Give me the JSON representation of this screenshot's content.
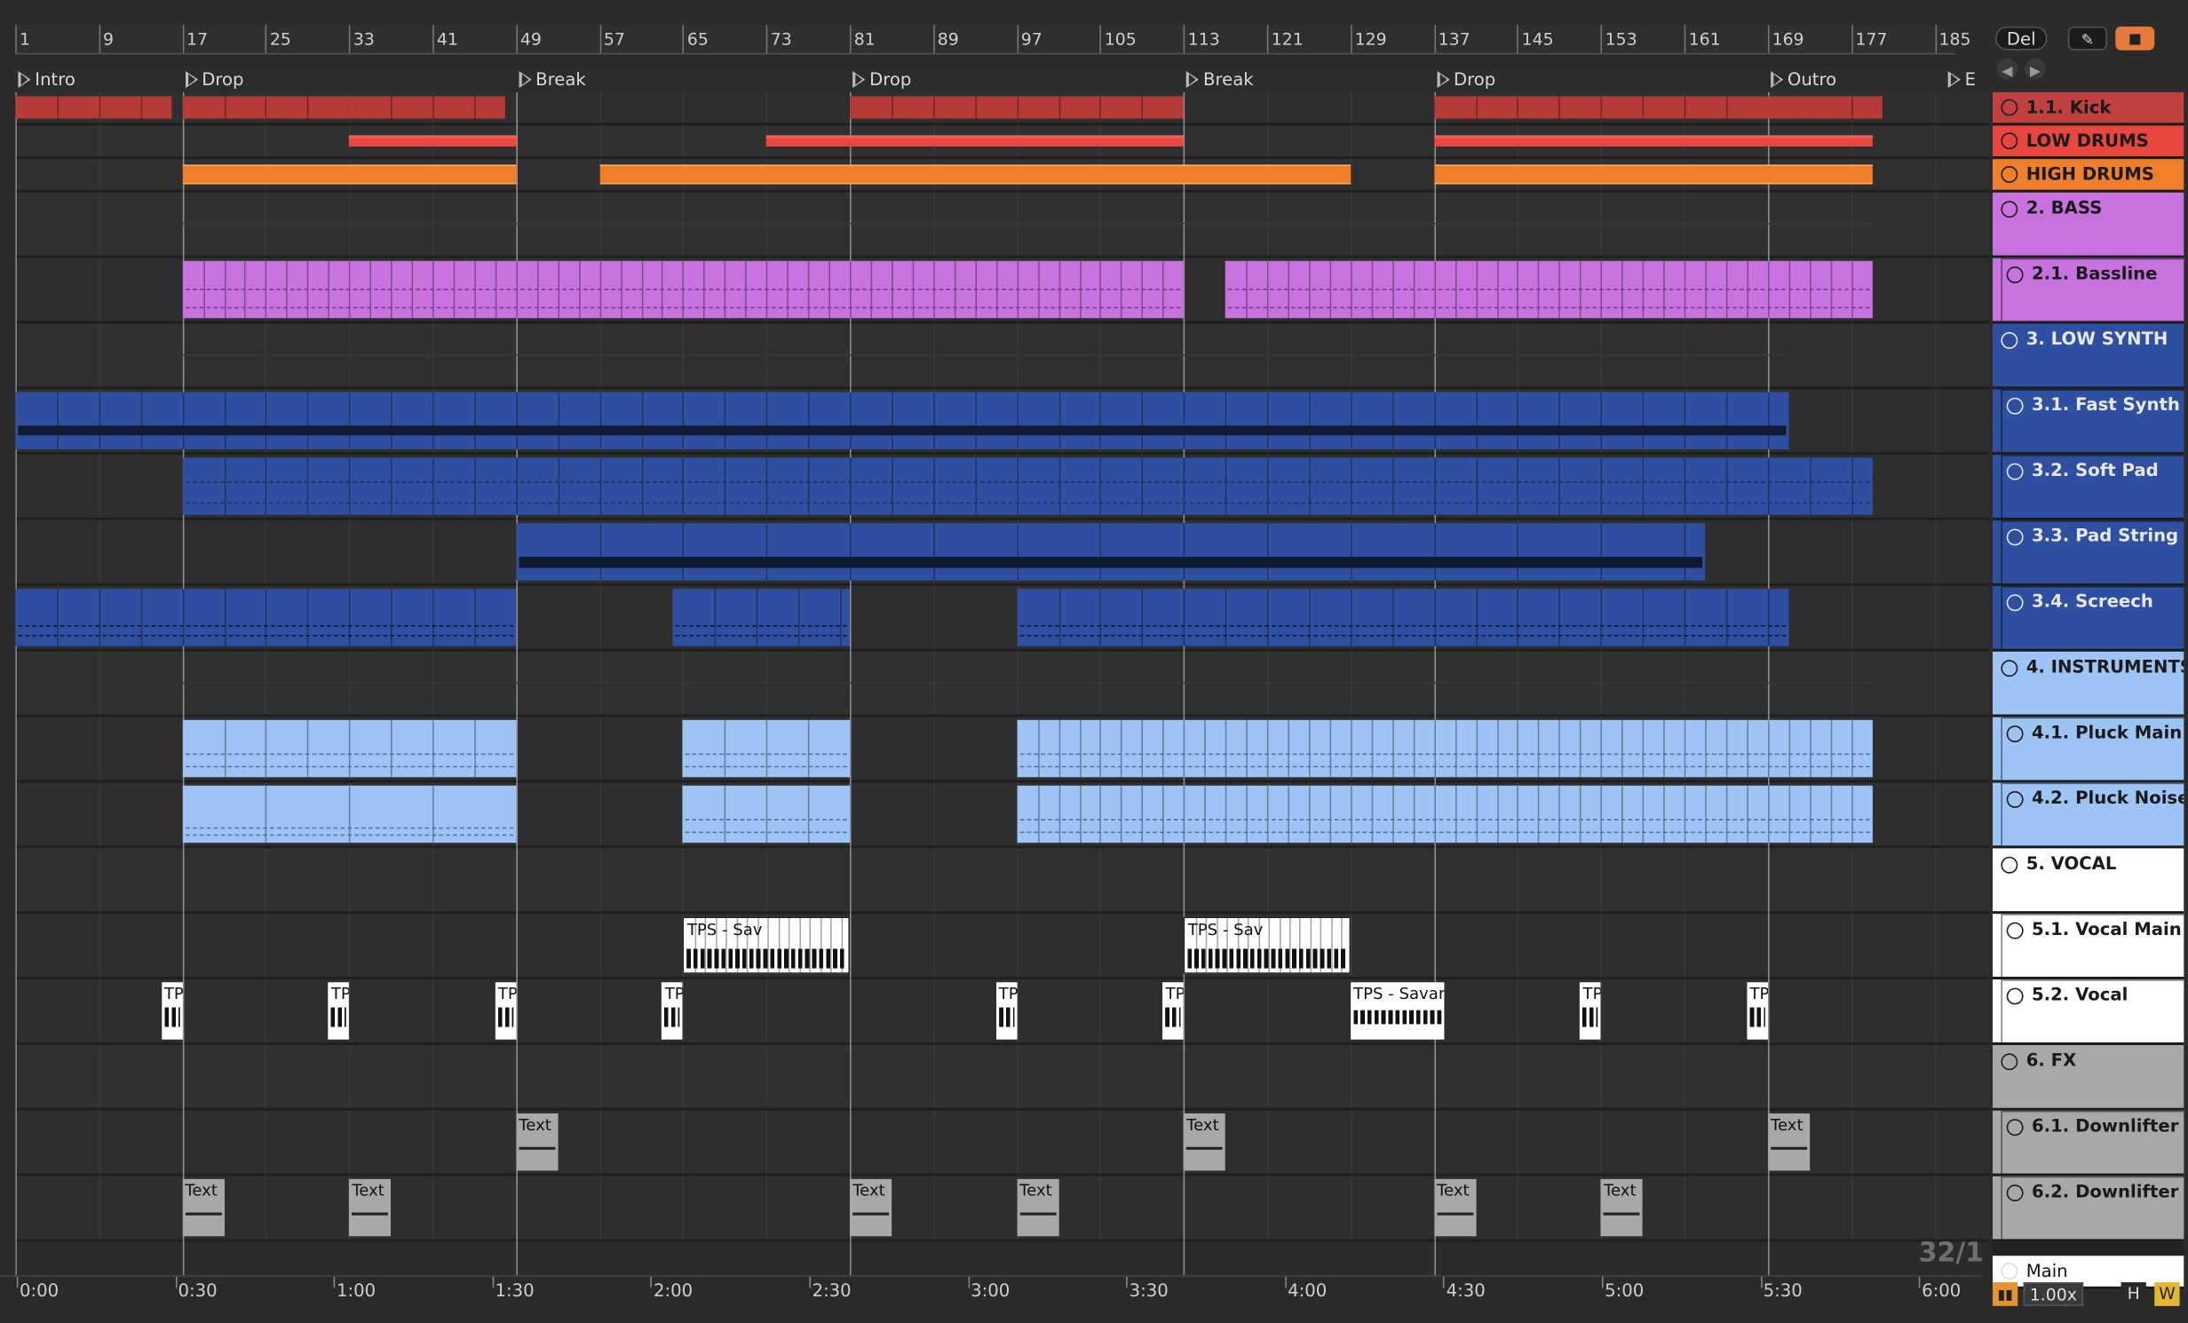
{
  "ruler": {
    "bars": [
      {
        "label": "1",
        "bar": 1
      },
      {
        "label": "9",
        "bar": 9
      },
      {
        "label": "17",
        "bar": 17
      },
      {
        "label": "25",
        "bar": 25
      },
      {
        "label": "33",
        "bar": 33
      },
      {
        "label": "41",
        "bar": 41
      },
      {
        "label": "49",
        "bar": 49
      },
      {
        "label": "57",
        "bar": 57
      },
      {
        "label": "65",
        "bar": 65
      },
      {
        "label": "73",
        "bar": 73
      },
      {
        "label": "81",
        "bar": 81
      },
      {
        "label": "89",
        "bar": 89
      },
      {
        "label": "97",
        "bar": 97
      },
      {
        "label": "105",
        "bar": 105
      },
      {
        "label": "113",
        "bar": 113
      },
      {
        "label": "121",
        "bar": 121
      },
      {
        "label": "129",
        "bar": 129
      },
      {
        "label": "137",
        "bar": 137
      },
      {
        "label": "145",
        "bar": 145
      },
      {
        "label": "153",
        "bar": 153
      },
      {
        "label": "161",
        "bar": 161
      },
      {
        "label": "169",
        "bar": 169
      },
      {
        "label": "177",
        "bar": 177
      },
      {
        "label": "185",
        "bar": 185
      }
    ]
  },
  "locators": [
    {
      "name": "Intro",
      "bar": 1
    },
    {
      "name": "Drop",
      "bar": 17
    },
    {
      "name": "Break",
      "bar": 49
    },
    {
      "name": "Drop",
      "bar": 81
    },
    {
      "name": "Break",
      "bar": 113
    },
    {
      "name": "Drop",
      "bar": 137
    },
    {
      "name": "Outro",
      "bar": 169
    },
    {
      "name": "E",
      "bar": 186
    }
  ],
  "time_ruler": [
    "0:00",
    "0:30",
    "1:00",
    "1:30",
    "2:00",
    "2:30",
    "3:00",
    "3:30",
    "4:00",
    "4:30",
    "5:00",
    "5:30",
    "6:00"
  ],
  "top_controls": {
    "del_label": "Del",
    "back_icon": "arrow-left-icon",
    "forward_icon": "arrow-right-icon"
  },
  "grid_readout": "32/1",
  "bottom_controls": {
    "zoom": "1.00x",
    "h_label": "H",
    "w_label": "W"
  },
  "colors": {
    "red": "#c0413d",
    "red2": "#e8473f",
    "orange": "#ef7f2a",
    "purple": "#c872e0",
    "blue": "#2f4fa0",
    "lightblue": "#9ec3f5",
    "white": "#ffffff",
    "gray": "#a8a8a8"
  },
  "tracks": [
    {
      "name": "1.1. Kick",
      "type": "audio",
      "color": "#c0413d"
    },
    {
      "name": "LOW DRUMS",
      "type": "group",
      "color": "#e8473f"
    },
    {
      "name": "HIGH DRUMS",
      "type": "group",
      "color": "#ef7f2a"
    },
    {
      "name": "2. BASS",
      "type": "group",
      "color": "#c872e0"
    },
    {
      "name": "2.1. Bassline",
      "type": "midi",
      "color": "#c872e0"
    },
    {
      "name": "3. LOW SYNTH",
      "type": "group",
      "color": "#2f4fa0"
    },
    {
      "name": "3.1. Fast Synth",
      "type": "midi",
      "color": "#2f4fa0"
    },
    {
      "name": "3.2. Soft Pad",
      "type": "midi",
      "color": "#2f4fa0"
    },
    {
      "name": "3.3. Pad String",
      "type": "midi",
      "color": "#2f4fa0"
    },
    {
      "name": "3.4. Screech",
      "type": "midi",
      "color": "#2f4fa0"
    },
    {
      "name": "4. INSTRUMENTS",
      "type": "group",
      "color": "#9ec3f5"
    },
    {
      "name": "4.1. Pluck Main",
      "type": "midi",
      "color": "#9ec3f5"
    },
    {
      "name": "4.2. Pluck Noise",
      "type": "midi",
      "color": "#9ec3f5"
    },
    {
      "name": "5. VOCAL",
      "type": "group",
      "color": "#ffffff"
    },
    {
      "name": "5.1. Vocal Main",
      "type": "midi",
      "color": "#ffffff"
    },
    {
      "name": "5.2. Vocal",
      "type": "midi",
      "color": "#ffffff"
    },
    {
      "name": "6. FX",
      "type": "group",
      "color": "#a8a8a8"
    },
    {
      "name": "6.1. Downlifter",
      "type": "midi",
      "color": "#a8a8a8"
    },
    {
      "name": "6.2. Downlifter",
      "type": "midi",
      "color": "#a8a8a8"
    },
    {
      "name": "Main",
      "type": "main",
      "color": "#ffffff"
    }
  ],
  "clip_labels": {
    "vocal_main": "TPS - Sav",
    "vocal_short": "TP",
    "vocal_long": "TPS - Savar",
    "fx_text": "Text"
  }
}
